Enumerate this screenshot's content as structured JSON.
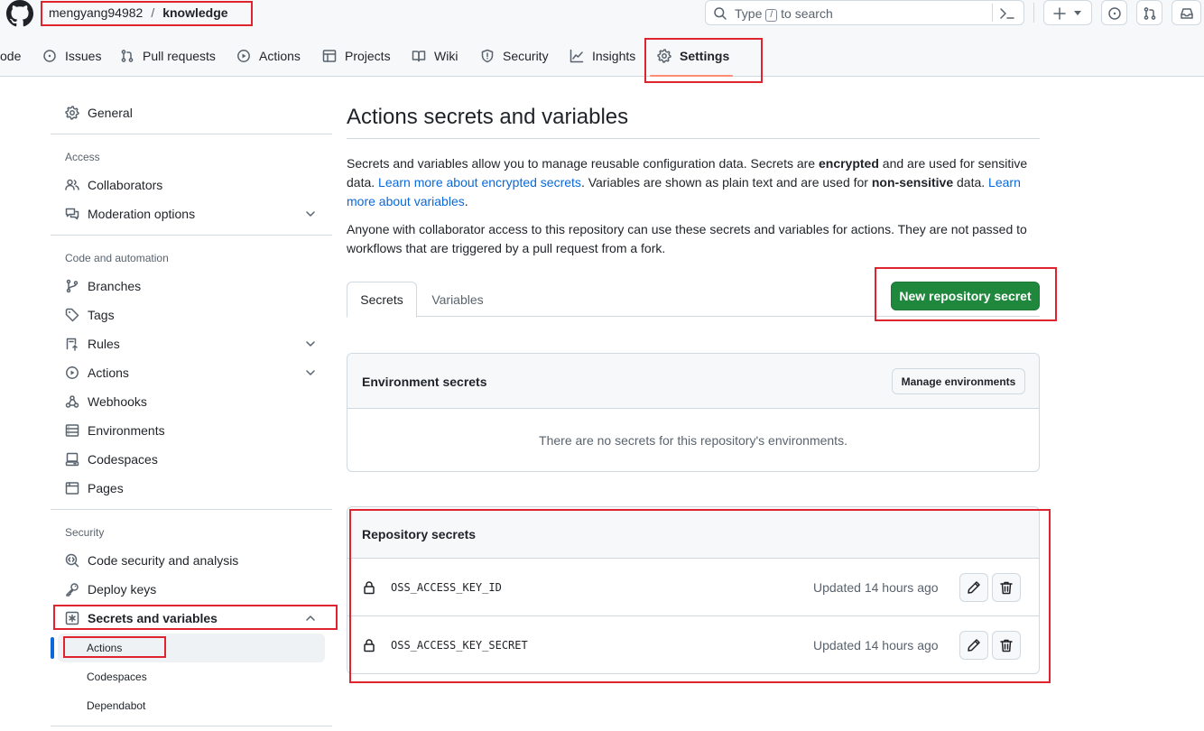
{
  "header": {
    "owner": "mengyang94982",
    "separator": "/",
    "repo": "knowledge",
    "search_placeholder_pre": "Type",
    "search_slash": "/",
    "search_placeholder_post": "to search"
  },
  "tabs": [
    {
      "label": "ode",
      "icon": "code-icon"
    },
    {
      "label": "Issues",
      "icon": "issue-icon"
    },
    {
      "label": "Pull requests",
      "icon": "pull-request-icon"
    },
    {
      "label": "Actions",
      "icon": "play-icon"
    },
    {
      "label": "Projects",
      "icon": "table-icon"
    },
    {
      "label": "Wiki",
      "icon": "book-icon"
    },
    {
      "label": "Security",
      "icon": "shield-icon"
    },
    {
      "label": "Insights",
      "icon": "graph-icon"
    },
    {
      "label": "Settings",
      "icon": "gear-icon",
      "selected": true
    }
  ],
  "sidebar": {
    "general": "General",
    "access_heading": "Access",
    "collaborators": "Collaborators",
    "moderation": "Moderation options",
    "code_heading": "Code and automation",
    "branches": "Branches",
    "tags": "Tags",
    "rules": "Rules",
    "actions": "Actions",
    "webhooks": "Webhooks",
    "environments": "Environments",
    "codespaces": "Codespaces",
    "pages": "Pages",
    "security_heading": "Security",
    "code_security": "Code security and analysis",
    "deploy_keys": "Deploy keys",
    "secrets_vars": "Secrets and variables",
    "sub_actions": "Actions",
    "sub_codespaces": "Codespaces",
    "sub_dependabot": "Dependabot"
  },
  "main": {
    "title": "Actions secrets and variables",
    "p1_a": "Secrets and variables allow you to manage reusable configuration data. Secrets are ",
    "p1_b": "encrypted",
    "p1_c": " and are used for sensitive data. ",
    "p1_link1": "Learn more about encrypted secrets",
    "p1_d": ". Variables are shown as plain text and are used for ",
    "p1_e": "non-sensitive",
    "p1_f": " data. ",
    "p1_link2": "Learn more about variables",
    "p1_g": ".",
    "p2": "Anyone with collaborator access to this repository can use these secrets and variables for actions. They are not passed to workflows that are triggered by a pull request from a fork.",
    "tab_secrets": "Secrets",
    "tab_variables": "Variables",
    "new_secret_button": "New repository secret",
    "env_title": "Environment secrets",
    "manage_env_button": "Manage environments",
    "env_empty": "There are no secrets for this repository's environments.",
    "repo_title": "Repository secrets",
    "secrets": [
      {
        "name": "OSS_ACCESS_KEY_ID",
        "updated": "Updated 14 hours ago"
      },
      {
        "name": "OSS_ACCESS_KEY_SECRET",
        "updated": "Updated 14 hours ago"
      }
    ]
  },
  "colors": {
    "accent_green": "#1f883d",
    "link_blue": "#0969da",
    "annotation_red": "#e0242f",
    "selected_tab_underline": "#fd8c73"
  }
}
